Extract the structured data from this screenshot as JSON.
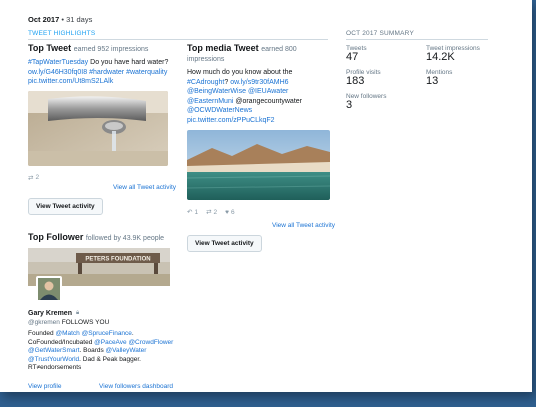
{
  "period": {
    "month": "Oct 2017",
    "days": " • 31 days"
  },
  "highlights_header": "TWEET HIGHLIGHTS",
  "top_tweet": {
    "title": "Top Tweet",
    "subtitle": "earned 952 impressions",
    "text_parts": {
      "hashtag1": "#TapWaterTuesday",
      "t1": " Do you have hard water? ",
      "link1": "ow.ly/G46H30fq0I8",
      "t2": " ",
      "hashtag2": "#hardwater",
      "t3": " ",
      "hashtag3": "#waterquality",
      "t4": " ",
      "link2": "pic.twitter.com/Ut8mS2LAlk"
    },
    "stats": {
      "retweets": "2"
    },
    "view_all": "View all Tweet activity",
    "button": "View Tweet activity"
  },
  "top_media_tweet": {
    "title": "Top media Tweet",
    "subtitle": "earned 800 impressions",
    "text_parts": {
      "t1": "How much do you know about the ",
      "hashtag1": "#CAdrought",
      "t2": "? ",
      "link1": "ow.ly/s9tr30fAMH6",
      "t3": " ",
      "mention1": "@BeingWaterWise",
      "t4": " ",
      "mention2": "@IEUAwater",
      "t5": " ",
      "mention3": "@EasternMuni",
      "t6": " @orangecountywater ",
      "mention4": "@OCWDWaterNews",
      "t7": " ",
      "link2": "pic.twitter.com/zPPuCLkqF2"
    },
    "stats": {
      "replies": "1",
      "retweets": "2",
      "likes": "6"
    },
    "view_all": "View all Tweet activity",
    "button": "View Tweet activity"
  },
  "top_follower": {
    "title": "Top Follower",
    "subtitle": "followed by 43.9K people",
    "banner_text": "PETERS FOUNDATION",
    "name": "Gary Kremen",
    "handle": "@gkremen",
    "follows_you": "FOLLOWS YOU",
    "bio_parts": {
      "t1": "Founded ",
      "m1": "@Match",
      "t2": " ",
      "m2": "@SpruceFinance",
      "t3": ". CoFounded/Incubated ",
      "m3": "@PaceAve",
      "t4": " ",
      "m4": "@CrowdFlower",
      "t5": " ",
      "m5": "@GetWaterSmart",
      "t6": ". Boards ",
      "m6": "@ValleyWater",
      "t7": " ",
      "m7": "@TrustYourWorld",
      "t8": ". Dad & Peak bagger. RT≠endorsements"
    },
    "view_profile": "View profile",
    "view_dashboard": "View followers dashboard"
  },
  "summary": {
    "header": "OCT 2017 SUMMARY",
    "items": [
      {
        "label": "Tweets",
        "value": "47"
      },
      {
        "label": "Tweet impressions",
        "value": "14.2K"
      },
      {
        "label": "Profile visits",
        "value": "183"
      },
      {
        "label": "Mentions",
        "value": "13"
      },
      {
        "label": "New followers",
        "value": "3"
      }
    ]
  },
  "colors": {
    "link": "#1b73d3",
    "accent": "#1da1f2",
    "muted": "#657786",
    "backdrop": "#2f5f8f"
  }
}
